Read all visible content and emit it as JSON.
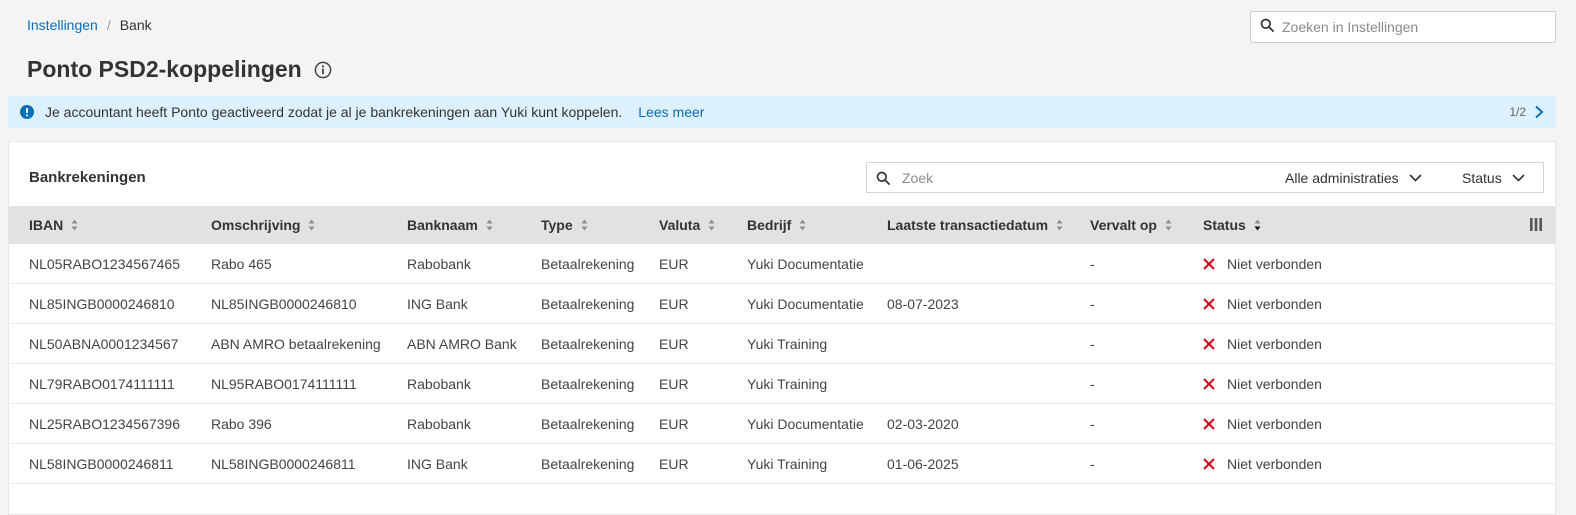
{
  "breadcrumb": {
    "root": "Instellingen",
    "separator": "/",
    "current": "Bank"
  },
  "search": {
    "placeholder": "Zoeken in Instellingen"
  },
  "page": {
    "title": "Ponto PSD2-koppelingen"
  },
  "banner": {
    "text": "Je accountant heeft Ponto geactiveerd zodat je al je bankrekeningen aan Yuki kunt koppelen.",
    "link": "Lees meer",
    "pager": "1/2"
  },
  "card": {
    "title": "Bankrekeningen",
    "search_placeholder": "Zoek",
    "filter_admin": "Alle administraties",
    "filter_status": "Status"
  },
  "table": {
    "columns": [
      "IBAN",
      "Omschrijving",
      "Banknaam",
      "Type",
      "Valuta",
      "Bedrijf",
      "Laatste transactiedatum",
      "Vervalt op",
      "Status"
    ],
    "rows": [
      {
        "iban": "NL05RABO1234567465",
        "omschrijving": "Rabo 465",
        "banknaam": "Rabobank",
        "type": "Betaalrekening",
        "valuta": "EUR",
        "bedrijf": "Yuki Documentatie",
        "laatste": "",
        "vervalt": "-",
        "status": "Niet verbonden"
      },
      {
        "iban": "NL85INGB0000246810",
        "omschrijving": "NL85INGB0000246810",
        "banknaam": "ING Bank",
        "type": "Betaalrekening",
        "valuta": "EUR",
        "bedrijf": "Yuki Documentatie",
        "laatste": "08-07-2023",
        "vervalt": "-",
        "status": "Niet verbonden"
      },
      {
        "iban": "NL50ABNA0001234567",
        "omschrijving": "ABN AMRO betaalrekening",
        "banknaam": "ABN AMRO Bank",
        "type": "Betaalrekening",
        "valuta": "EUR",
        "bedrijf": "Yuki Training",
        "laatste": "",
        "vervalt": "-",
        "status": "Niet verbonden"
      },
      {
        "iban": "NL79RABO0174111111",
        "omschrijving": "NL95RABO0174111111",
        "banknaam": "Rabobank",
        "type": "Betaalrekening",
        "valuta": "EUR",
        "bedrijf": "Yuki Training",
        "laatste": "",
        "vervalt": "-",
        "status": "Niet verbonden"
      },
      {
        "iban": "NL25RABO1234567396",
        "omschrijving": "Rabo 396",
        "banknaam": "Rabobank",
        "type": "Betaalrekening",
        "valuta": "EUR",
        "bedrijf": "Yuki Documentatie",
        "laatste": "02-03-2020",
        "vervalt": "-",
        "status": "Niet verbonden"
      },
      {
        "iban": "NL58INGB0000246811",
        "omschrijving": "NL58INGB0000246811",
        "banknaam": "ING Bank",
        "type": "Betaalrekening",
        "valuta": "EUR",
        "bedrijf": "Yuki Training",
        "laatste": "01-06-2025",
        "vervalt": "-",
        "status": "Niet verbonden"
      }
    ]
  },
  "colors": {
    "link": "#0a6fb5",
    "banner_bg": "#dcf1fd",
    "error": "#d0021b",
    "header_bg": "#e2e2e2"
  },
  "icons": {
    "search": "search-icon",
    "info": "info-icon",
    "alert": "alert-circle-icon",
    "status_x": "x-icon",
    "chevron": "chevron-down-icon",
    "columns": "columns-icon"
  }
}
